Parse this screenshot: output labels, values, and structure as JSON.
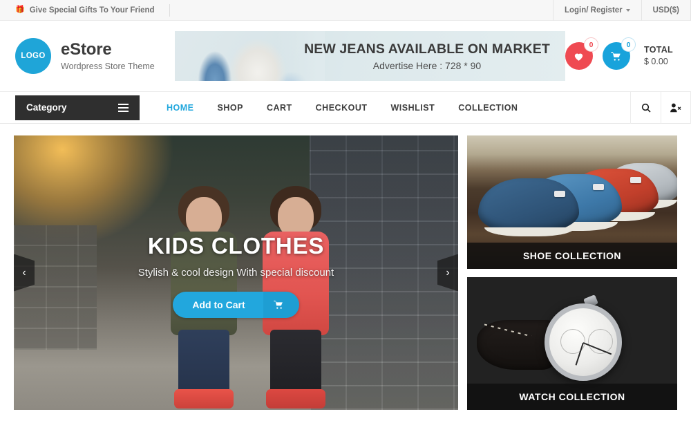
{
  "topbar": {
    "gift_icon": "gift-icon",
    "promo_text": "Give Special Gifts To Your Friend",
    "login_label": "Login/ Register",
    "currency_label": "USD($)"
  },
  "header": {
    "logo_text": "LOGO",
    "brand_name": "eStore",
    "brand_tagline": "Wordpress Store Theme",
    "ad": {
      "title": "NEW JEANS AVAILABLE ON MARKET",
      "subtitle": "Advertise Here : 728 * 90"
    },
    "wishlist_count": "0",
    "cart_count": "0",
    "total_label": "TOTAL",
    "total_value": "$ 0.00",
    "wishlist_color": "#ef4a52",
    "cart_color": "#18a3db"
  },
  "nav": {
    "category_label": "Category",
    "menu": [
      {
        "label": "HOME",
        "active": true
      },
      {
        "label": "SHOP",
        "active": false
      },
      {
        "label": "CART",
        "active": false
      },
      {
        "label": "CHECKOUT",
        "active": false
      },
      {
        "label": "WISHLIST",
        "active": false
      },
      {
        "label": "COLLECTION",
        "active": false
      }
    ],
    "active_color": "#21a7dd",
    "icons": [
      "search-icon",
      "user-times-icon"
    ]
  },
  "hero": {
    "title": "KIDS CLOTHES",
    "subtitle": "Stylish & cool design With special discount",
    "button_label": "Add to Cart",
    "button_color": "#22a7dd",
    "prev_arrow": "‹",
    "next_arrow": "›"
  },
  "collections": [
    {
      "caption": "SHOE COLLECTION"
    },
    {
      "caption": "WATCH COLLECTION"
    }
  ]
}
